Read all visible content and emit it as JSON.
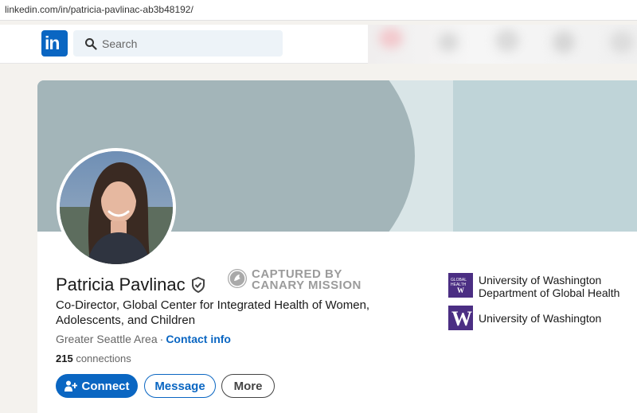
{
  "browser": {
    "url": "linkedin.com/in/patricia-pavlinac-ab3b48192/"
  },
  "navbar": {
    "logo_text": "in",
    "search_placeholder": "Search"
  },
  "profile": {
    "name": "Patricia Pavlinac",
    "headline": "Co-Director, Global Center for Integrated Health of Women, Adolescents, and Children",
    "location": "Greater Seattle Area",
    "separator": "·",
    "contact_label": "Contact info",
    "connections_count": "215",
    "connections_label": "connections"
  },
  "watermark": {
    "line1": "CAPTURED BY",
    "line2": "CANARY MISSION"
  },
  "actions": {
    "connect_label": "Connect",
    "message_label": "Message",
    "more_label": "More"
  },
  "experience": [
    {
      "logo_line1": "GLOBAL",
      "logo_line2": "HEALTH",
      "logo_mark": "W",
      "line1": "University of Washington",
      "line2": "Department of Global Health"
    },
    {
      "logo_mark": "W",
      "line1": "University of Washington"
    }
  ],
  "colors": {
    "brand": "#0a66c2",
    "uw_purple": "#4b2e83",
    "banner": "#bfd4d8"
  },
  "icons": [
    "search-icon",
    "verified-shield-icon",
    "add-person-icon",
    "canary-mission-icon"
  ]
}
